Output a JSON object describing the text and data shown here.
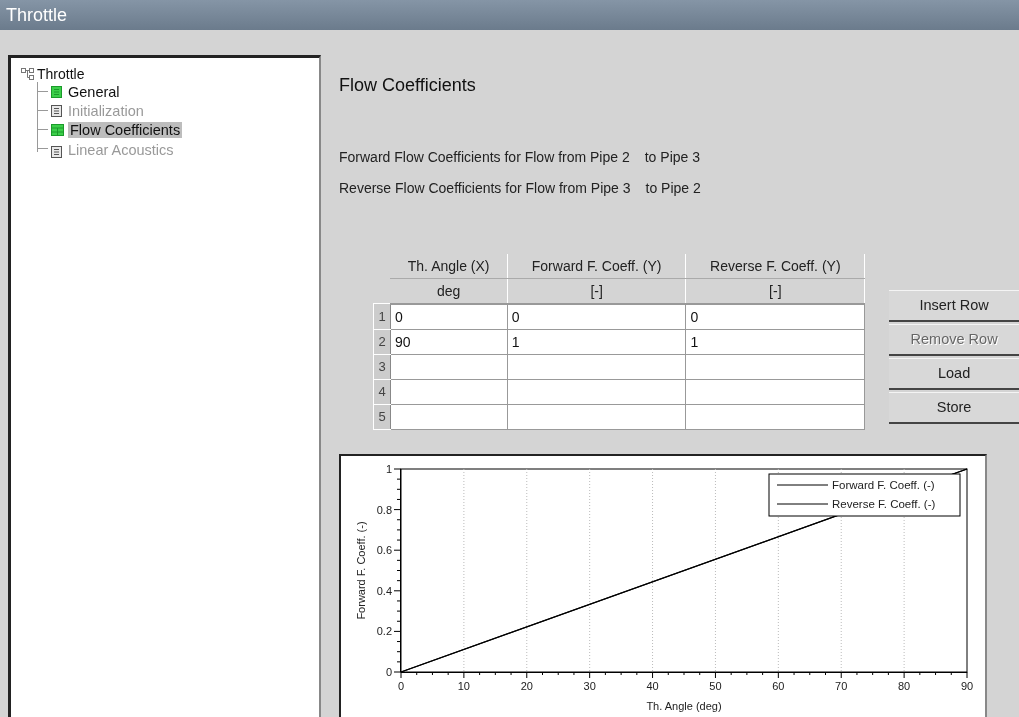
{
  "window": {
    "title": "Throttle"
  },
  "tree": {
    "label": "Throttle",
    "children": [
      {
        "label": "General",
        "kind": "form",
        "selected": false,
        "disabled": false
      },
      {
        "label": "Initialization",
        "kind": "form",
        "selected": false,
        "disabled": true
      },
      {
        "label": "Flow Coefficients",
        "kind": "table",
        "selected": true,
        "disabled": false
      },
      {
        "label": "Linear Acoustics",
        "kind": "form",
        "selected": false,
        "disabled": true
      }
    ]
  },
  "panel": {
    "heading": "Flow Coefficients",
    "lines": [
      {
        "text": "Forward Flow Coefficients for Flow from Pipe 2",
        "target": "to Pipe 3"
      },
      {
        "text": "Reverse Flow Coefficients for Flow from Pipe 3",
        "target": "to Pipe 2"
      }
    ],
    "table": {
      "columns": [
        {
          "label": "Th. Angle (X)",
          "unit": "deg"
        },
        {
          "label": "Forward F. Coeff. (Y)",
          "unit": "[-]"
        },
        {
          "label": "Reverse F. Coeff. (Y)",
          "unit": "[-]"
        }
      ],
      "rows": [
        {
          "number": "1",
          "cells": [
            "0",
            "0",
            "0"
          ]
        },
        {
          "number": "2",
          "cells": [
            "90",
            "1",
            "1"
          ]
        },
        {
          "number": "3"
        },
        {
          "number": "4"
        },
        {
          "number": "5"
        }
      ]
    },
    "buttons": [
      {
        "label": "Insert Row",
        "disabled": false
      },
      {
        "label": "Remove Row",
        "disabled": true
      },
      {
        "label": "Load",
        "disabled": false
      },
      {
        "label": "Store",
        "disabled": false
      }
    ],
    "chart_data": {
      "type": "line",
      "xlabel": "Th. Angle (deg)",
      "ylabel": "Forward F. Coeff. (-)",
      "x": [
        0,
        90
      ],
      "series": [
        {
          "name": "Forward F. Coeff. (-)",
          "color": "#000000",
          "values": [
            0,
            1
          ]
        },
        {
          "name": "Reverse F. Coeff. (-)",
          "color": "#000000",
          "values": [
            0,
            1
          ]
        }
      ],
      "grid": true,
      "legend": true,
      "xlim": [
        0,
        90
      ],
      "ylim": [
        0,
        1
      ],
      "xticks": [
        0,
        10,
        20,
        30,
        40,
        50,
        60,
        70,
        80,
        90
      ],
      "yticks": [
        0,
        0.2,
        0.4,
        0.6,
        0.8,
        1
      ]
    }
  }
}
